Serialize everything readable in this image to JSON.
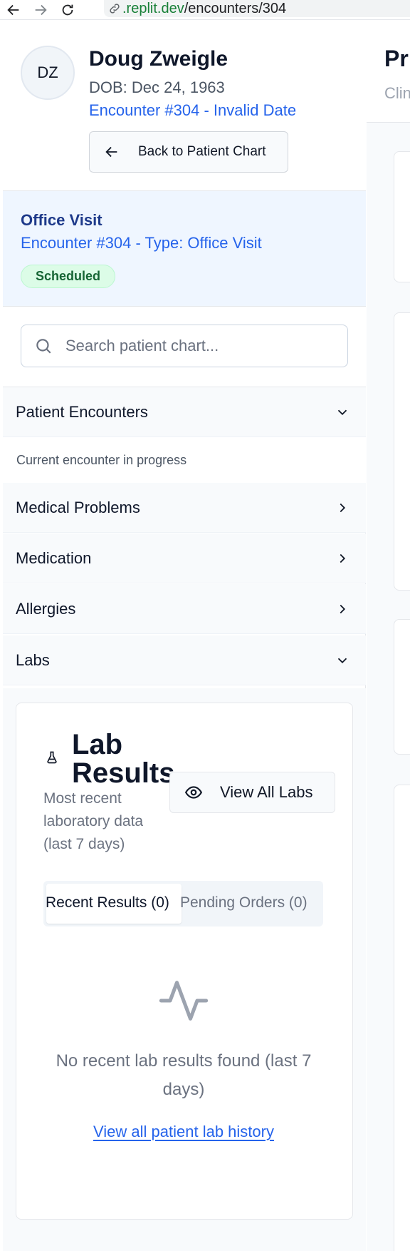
{
  "browser": {
    "url_host": ".replit.dev",
    "url_path": "/encounters/304"
  },
  "patient": {
    "initials": "DZ",
    "name": "Doug Zweigle",
    "dob": "DOB: Dec 24, 1963",
    "encounter_link": "Encounter #304 - Invalid Date",
    "back_button": "Back to Patient Chart"
  },
  "visit": {
    "title": "Office Visit",
    "subtitle": "Encounter #304 - Type: Office Visit",
    "status": "Scheduled"
  },
  "search": {
    "placeholder": "Search patient chart..."
  },
  "sections": {
    "encounters": "Patient Encounters",
    "encounters_note": "Current encounter in progress",
    "medical_problems": "Medical Problems",
    "medication": "Medication",
    "allergies": "Allergies",
    "labs": "Labs"
  },
  "labs": {
    "title": "Lab Results",
    "description": "Most recent laboratory data (last 7 days)",
    "view_all": "View All Labs",
    "tab_recent": "Recent Results (0)",
    "tab_pending": "Pending Orders (0)",
    "empty_message": "No recent lab results found (last 7 days)",
    "history_link": "View all patient lab history"
  },
  "main": {
    "title": "Pr",
    "subtitle": "Clin"
  },
  "colors": {
    "accent": "#2563eb",
    "visit_bg": "#eff6ff",
    "badge_bg": "#dcfce7",
    "badge_text": "#166534"
  }
}
